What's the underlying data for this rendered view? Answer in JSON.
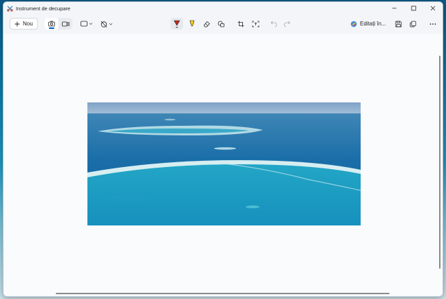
{
  "window": {
    "title": "Instrument de decupare",
    "controls": [
      "minimize-icon",
      "maximize-icon",
      "close-icon"
    ]
  },
  "toolbar": {
    "new_label": "Nou",
    "edit_in_label": "Editați în...",
    "modes": [
      "camera-icon",
      "video-icon"
    ],
    "active_mode": "camera-icon",
    "tools": [
      "snip-shape-icon",
      "timer-off-icon",
      "ballpoint-pen-icon",
      "highlighter-icon",
      "eraser-icon",
      "shapes-icon",
      "crop-icon",
      "text-actions-icon",
      "undo-icon",
      "redo-icon",
      "save-icon",
      "copy-icon",
      "more-icon"
    ],
    "pen_color": "#c42b1c",
    "highlighter_color": "#f4d00c"
  },
  "colors": {
    "accent": "#005fb8",
    "window_bg": "#f3f5f8",
    "canvas_bg": "#fafbfd"
  }
}
